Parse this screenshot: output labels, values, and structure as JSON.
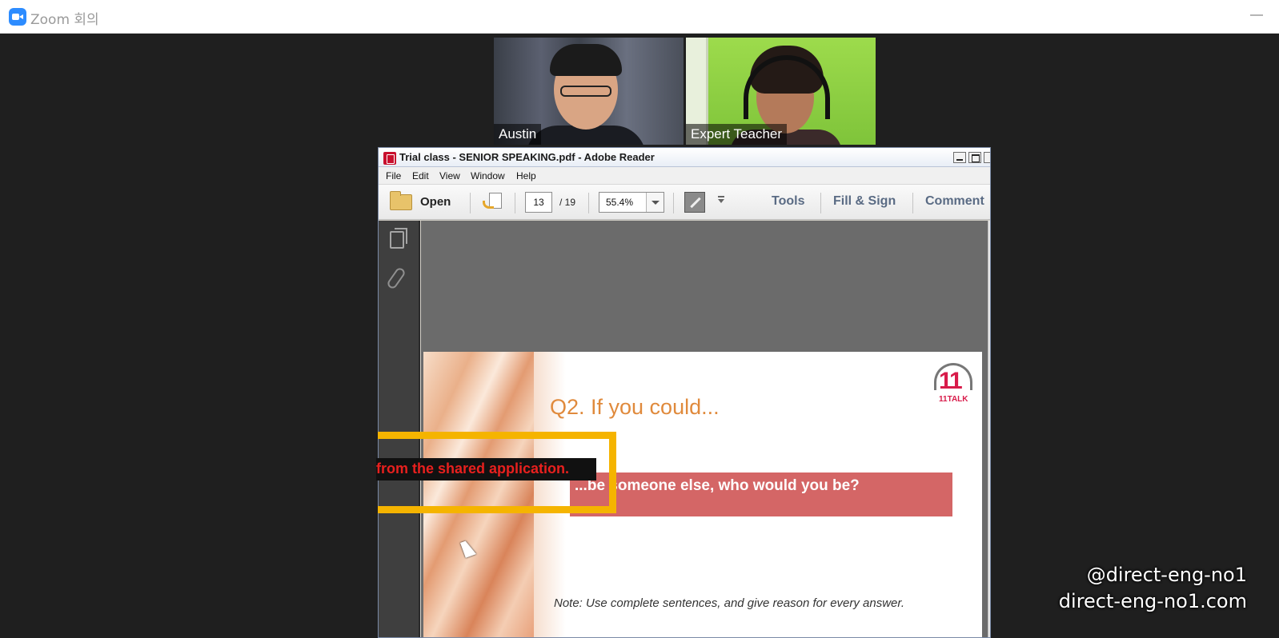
{
  "zoom": {
    "title": "Zoom 회의",
    "participants": [
      {
        "name": "Austin"
      },
      {
        "name": "Expert Teacher"
      }
    ]
  },
  "reader": {
    "title": "Trial class - SENIOR SPEAKING.pdf - Adobe Reader",
    "menu": [
      "File",
      "Edit",
      "View",
      "Window",
      "Help"
    ],
    "toolbar": {
      "open_label": "Open",
      "page_current": "13",
      "page_total": "/  19",
      "zoom_value": "55.4%",
      "tools_label": "Tools",
      "fill_sign_label": "Fill & Sign",
      "comment_label": "Comment"
    },
    "slide": {
      "logo_glyph": "11",
      "logo_text": "11TALK",
      "title": "Q2. If you could...",
      "question": "...be someone else, who would you be?",
      "note": "Note: Use complete sentences, and give reason for every answer."
    }
  },
  "share_notice": "from the shared application.",
  "watermark": {
    "line1": "@direct-eng-no1",
    "line2": "direct-eng-no1.com"
  },
  "colors": {
    "zoom_blue": "#2d8cff",
    "highlight": "#f5b400",
    "notice_red": "#e8201e",
    "slide_title": "#e08a3c",
    "question_box": "#d46666",
    "logo": "#d81b4a"
  },
  "icons": [
    "zoom-camera-icon",
    "minimize-icon",
    "pdf-file-icon",
    "folder-icon",
    "send-file-icon",
    "dropdown-arrow-icon",
    "fit-page-icon",
    "more-tools-icon",
    "pages-panel-icon",
    "attachment-paperclip-icon",
    "mouse-cursor-icon"
  ]
}
